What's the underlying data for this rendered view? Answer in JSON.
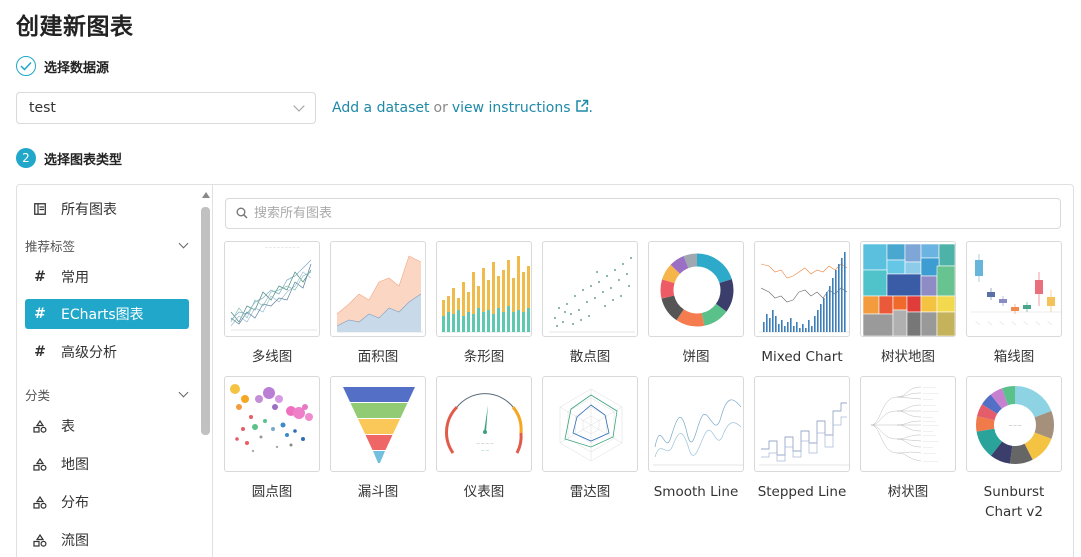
{
  "page": {
    "title": "创建新图表"
  },
  "step1": {
    "number": "1",
    "label": "选择数据源"
  },
  "dataset": {
    "selected": "test"
  },
  "help": {
    "add_link": "Add a dataset",
    "or": "or",
    "view_link": "view instructions",
    "period": "."
  },
  "step2": {
    "number": "2",
    "label": "选择图表类型"
  },
  "sidebar": {
    "all_charts": "所有图表",
    "recommended_section": "推荐标签",
    "tags": [
      {
        "label": "常用"
      },
      {
        "label": "ECharts图表"
      },
      {
        "label": "高级分析"
      }
    ],
    "category_section": "分类",
    "categories": [
      {
        "label": "表"
      },
      {
        "label": "地图"
      },
      {
        "label": "分布"
      },
      {
        "label": "流图"
      }
    ]
  },
  "search": {
    "placeholder": "搜索所有图表"
  },
  "charts": [
    {
      "label": "多线图"
    },
    {
      "label": "面积图"
    },
    {
      "label": "条形图"
    },
    {
      "label": "散点图"
    },
    {
      "label": "饼图"
    },
    {
      "label": "Mixed Chart"
    },
    {
      "label": "树状地图"
    },
    {
      "label": "箱线图"
    },
    {
      "label": "圆点图"
    },
    {
      "label": "漏斗图"
    },
    {
      "label": "仪表图"
    },
    {
      "label": "雷达图"
    },
    {
      "label": "Smooth Line"
    },
    {
      "label": "Stepped Line"
    },
    {
      "label": "树状图"
    },
    {
      "label": "Sunburst Chart v2"
    }
  ],
  "colors": {
    "accent": "#20a7c9",
    "link": "#1f8aa8"
  }
}
